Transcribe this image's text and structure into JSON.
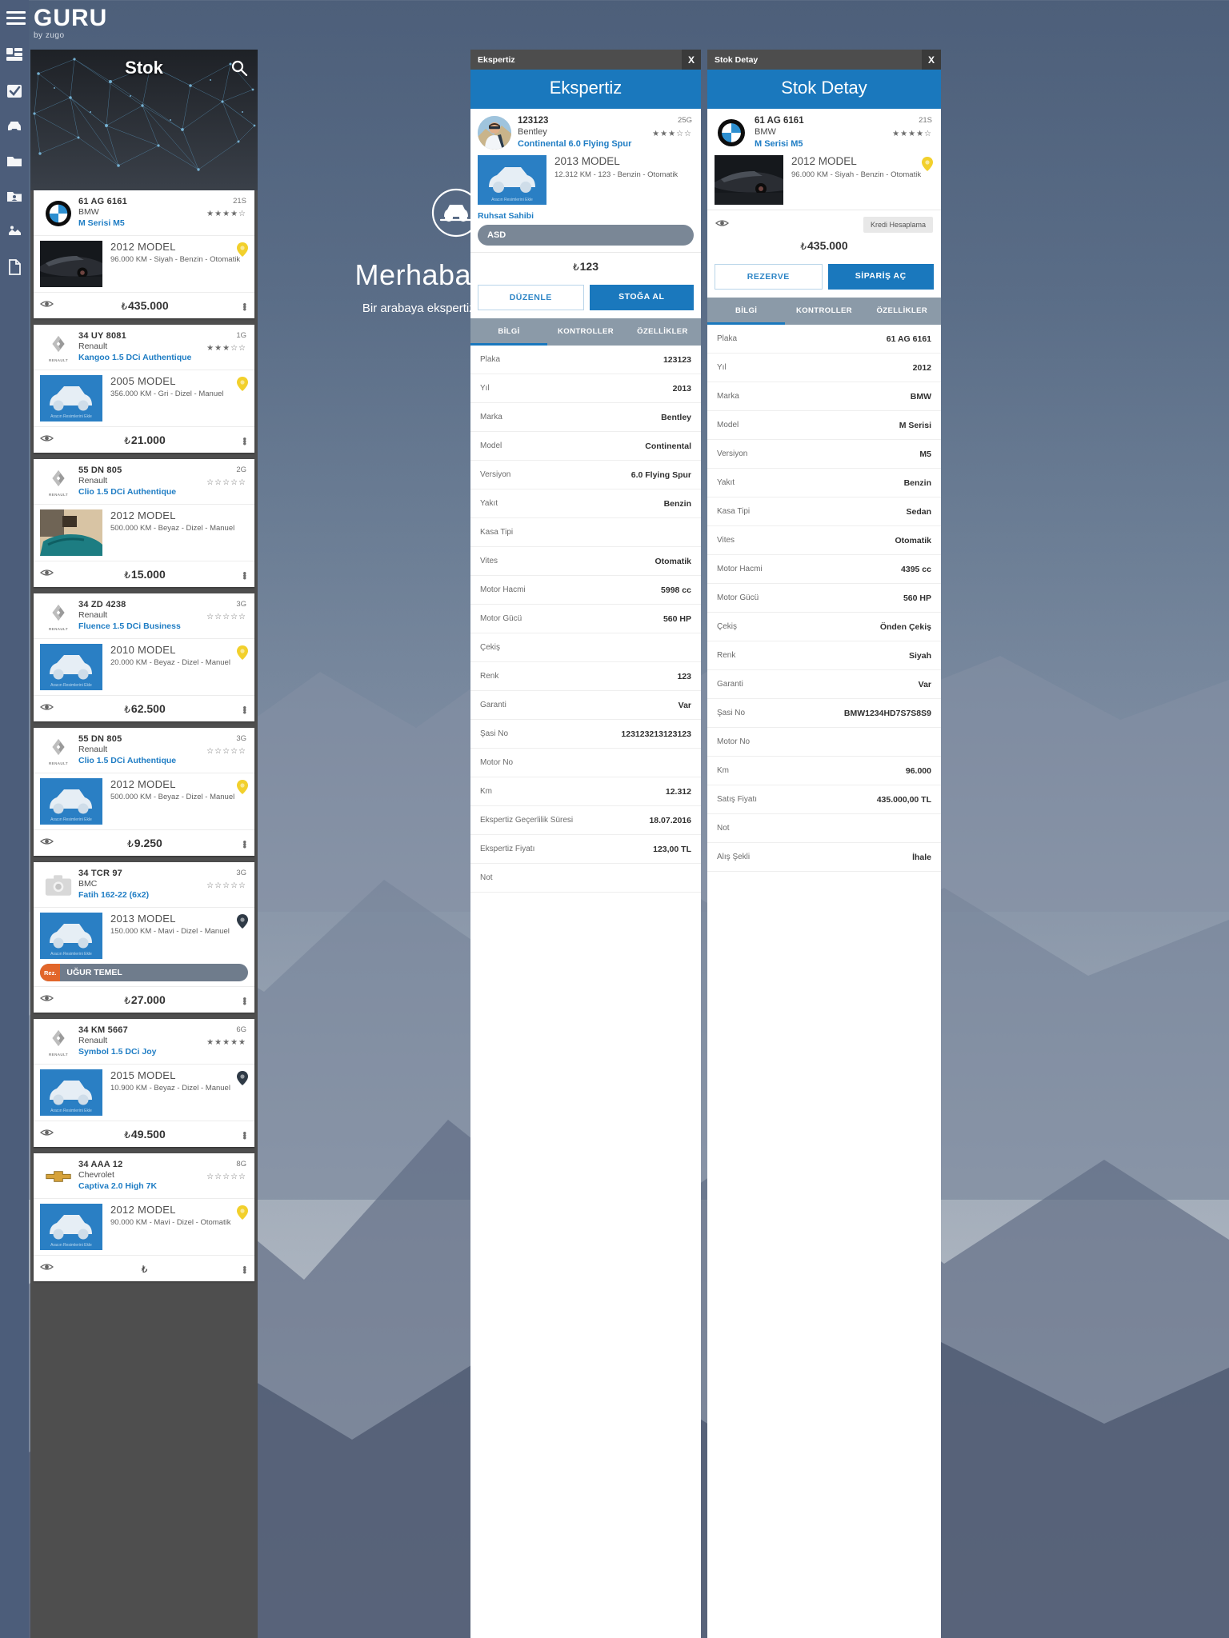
{
  "brand": {
    "name": "GURU",
    "sub": "by zugo"
  },
  "rail": {
    "items": [
      {
        "name": "dashboard-icon",
        "label": "Dashboard"
      },
      {
        "name": "tasks-icon",
        "label": "Görevler"
      },
      {
        "name": "car-icon",
        "label": "Araçlar"
      },
      {
        "name": "folder-icon",
        "label": "Klasör"
      },
      {
        "name": "customer-folder-icon",
        "label": "Müşteriler"
      },
      {
        "name": "handshake-icon",
        "label": "Satış"
      },
      {
        "name": "document-icon",
        "label": "Belgeler"
      }
    ]
  },
  "stok": {
    "title": "Stok",
    "search_icon": "search-icon",
    "cards": [
      {
        "plate": "61 AG 6161",
        "brand": "BMW",
        "model": "M Serisi M5",
        "code": "21S",
        "stars": 4,
        "year": "2012 MODEL",
        "spec": "96.000 KM - Siyah - Benzin - Otomatik",
        "price": "435.000",
        "currency": "₺",
        "logo": "bmw",
        "thumb": "photo-bmw",
        "pin": "yellow",
        "reserved": null
      },
      {
        "plate": "34 UY 8081",
        "brand": "Renault",
        "model": "Kangoo 1.5 DCi Authentique",
        "code": "1G",
        "stars": 3,
        "year": "2005 MODEL",
        "spec": "356.000 KM - Gri - Dizel - Manuel",
        "price": "21.000",
        "currency": "₺",
        "logo": "renault",
        "thumb": "placeholder",
        "pin": "yellow",
        "reserved": null
      },
      {
        "plate": "55 DN 805",
        "brand": "Renault",
        "model": "Clio 1.5 DCi Authentique",
        "code": "2G",
        "stars": 0,
        "year": "2012 MODEL",
        "spec": "500.000 KM - Beyaz - Dizel - Manuel",
        "price": "15.000",
        "currency": "₺",
        "logo": "renault",
        "thumb": "photo-teal",
        "pin": null,
        "reserved": null
      },
      {
        "plate": "34 ZD 4238",
        "brand": "Renault",
        "model": "Fluence 1.5 DCi Business",
        "code": "3G",
        "stars": 0,
        "year": "2010 MODEL",
        "spec": "20.000 KM - Beyaz - Dizel - Manuel",
        "price": "62.500",
        "currency": "₺",
        "logo": "renault",
        "thumb": "placeholder",
        "pin": "yellow",
        "reserved": null
      },
      {
        "plate": "55 DN 805",
        "brand": "Renault",
        "model": "Clio 1.5 DCi Authentique",
        "code": "3G",
        "stars": 0,
        "year": "2012 MODEL",
        "spec": "500.000 KM - Beyaz - Dizel - Manuel",
        "price": "9.250",
        "currency": "₺",
        "logo": "renault",
        "thumb": "placeholder",
        "pin": "yellow",
        "reserved": null
      },
      {
        "plate": "34 TCR 97",
        "brand": "BMC",
        "model": "Fatih 162-22 (6x2)",
        "code": "3G",
        "stars": 0,
        "year": "2013 MODEL",
        "spec": "150.000 KM - Mavi - Dizel - Manuel",
        "price": "27.000",
        "currency": "₺",
        "logo": "camera",
        "thumb": "placeholder",
        "pin": "dark",
        "reserved": {
          "tag": "Rez.",
          "name": "UĞUR TEMEL"
        }
      },
      {
        "plate": "34 KM 5667",
        "brand": "Renault",
        "model": "Symbol 1.5 DCi Joy",
        "code": "6G",
        "stars": 5,
        "year": "2015 MODEL",
        "spec": "10.900 KM - Beyaz - Dizel - Manuel",
        "price": "49.500",
        "currency": "₺",
        "logo": "renault",
        "thumb": "placeholder",
        "pin": "dark",
        "reserved": null
      },
      {
        "plate": "34 AAA 12",
        "brand": "Chevrolet",
        "model": "Captiva 2.0 High 7K",
        "code": "8G",
        "stars": 0,
        "year": "2012 MODEL",
        "spec": "90.000 KM - Mavi - Dizel - Otomatik",
        "price": "",
        "currency": "₺",
        "logo": "chevrolet",
        "thumb": "placeholder",
        "pin": "yellow",
        "reserved": null
      }
    ]
  },
  "welcome": {
    "icon": "car-badge-icon",
    "title": "Merhaba İsmail",
    "subtitle": "Bir arabaya ekspertiz yaparak veya"
  },
  "ekspertiz": {
    "window_title": "Ekspertiz",
    "close_label": "X",
    "banner": "Ekspertiz",
    "card": {
      "plate": "123123",
      "brand": "Bentley",
      "model": "Continental 6.0 Flying Spur",
      "code": "25G",
      "stars": 3,
      "year": "2013 MODEL",
      "spec": "12.312 KM - 123 - Benzin - Otomatik",
      "thumb_caption": "Aracın Resimlerini Ekle"
    },
    "ruhsat_label": "Ruhsat Sahibi",
    "owner_value": "ASD",
    "price": "123",
    "currency": "₺",
    "buttons": {
      "edit": "DÜZENLE",
      "stock": "STOĞA AL"
    },
    "tabs": [
      {
        "label": "BİLGİ",
        "active": true
      },
      {
        "label": "KONTROLLER",
        "active": false
      },
      {
        "label": "ÖZELLİKLER",
        "active": false
      }
    ],
    "rows": [
      {
        "key": "Plaka",
        "value": "123123"
      },
      {
        "key": "Yıl",
        "value": "2013"
      },
      {
        "key": "Marka",
        "value": "Bentley"
      },
      {
        "key": "Model",
        "value": "Continental"
      },
      {
        "key": "Versiyon",
        "value": "6.0 Flying Spur"
      },
      {
        "key": "Yakıt",
        "value": "Benzin"
      },
      {
        "key": "Kasa Tipi",
        "value": ""
      },
      {
        "key": "Vites",
        "value": "Otomatik"
      },
      {
        "key": "Motor Hacmi",
        "value": "5998 cc"
      },
      {
        "key": "Motor Gücü",
        "value": "560 HP"
      },
      {
        "key": "Çekiş",
        "value": ""
      },
      {
        "key": "Renk",
        "value": "123"
      },
      {
        "key": "Garanti",
        "value": "Var"
      },
      {
        "key": "Şasi No",
        "value": "123123213123123"
      },
      {
        "key": "Motor No",
        "value": ""
      },
      {
        "key": "Km",
        "value": "12.312"
      },
      {
        "key": "Ekspertiz Geçerlilik Süresi",
        "value": "18.07.2016"
      },
      {
        "key": "Ekspertiz Fiyatı",
        "value": "123,00 TL"
      },
      {
        "key": "Not",
        "value": ""
      }
    ]
  },
  "stokdetay": {
    "window_title": "Stok Detay",
    "close_label": "X",
    "banner": "Stok Detay",
    "card": {
      "plate": "61 AG 6161",
      "brand": "BMW",
      "model": "M Serisi M5",
      "code": "21S",
      "stars": 4,
      "year": "2012 MODEL",
      "spec": "96.000 KM - Siyah - Benzin - Otomatik"
    },
    "credit_button": "Kredi Hesaplama",
    "price": "435.000",
    "currency": "₺",
    "buttons": {
      "reserve": "REZERVE",
      "order": "SİPARİŞ AÇ"
    },
    "tabs": [
      {
        "label": "BİLGİ",
        "active": true
      },
      {
        "label": "KONTROLLER",
        "active": false
      },
      {
        "label": "ÖZELLİKLER",
        "active": false
      }
    ],
    "rows": [
      {
        "key": "Plaka",
        "value": "61 AG 6161"
      },
      {
        "key": "Yıl",
        "value": "2012"
      },
      {
        "key": "Marka",
        "value": "BMW"
      },
      {
        "key": "Model",
        "value": "M Serisi"
      },
      {
        "key": "Versiyon",
        "value": "M5"
      },
      {
        "key": "Yakıt",
        "value": "Benzin"
      },
      {
        "key": "Kasa Tipi",
        "value": "Sedan"
      },
      {
        "key": "Vites",
        "value": "Otomatik"
      },
      {
        "key": "Motor Hacmi",
        "value": "4395 cc"
      },
      {
        "key": "Motor Gücü",
        "value": "560 HP"
      },
      {
        "key": "Çekiş",
        "value": "Önden Çekiş"
      },
      {
        "key": "Renk",
        "value": "Siyah"
      },
      {
        "key": "Garanti",
        "value": "Var"
      },
      {
        "key": "Şasi No",
        "value": "BMW1234HD7S7S8S9"
      },
      {
        "key": "Motor No",
        "value": ""
      },
      {
        "key": "Km",
        "value": "96.000"
      },
      {
        "key": "Satış Fiyatı",
        "value": "435.000,00 TL"
      },
      {
        "key": "Not",
        "value": ""
      },
      {
        "key": "Alış Şekli",
        "value": "İhale"
      }
    ]
  },
  "colors": {
    "accent": "#1a78bd",
    "link": "#1f7dc4",
    "rail": "#4c5d7a",
    "titlebar": "#4d4d4d",
    "tabbar": "#8b9aa8",
    "reserve_tag": "#e2662a",
    "pin_yellow": "#f2d02c"
  }
}
